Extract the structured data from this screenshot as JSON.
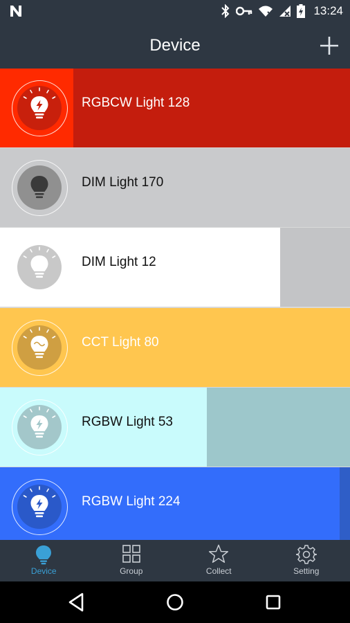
{
  "status_bar": {
    "time": "13:24"
  },
  "header": {
    "title": "Device"
  },
  "devices": [
    {
      "name": "RGBCW Light 128",
      "row_bg": "#c41d0d",
      "fill_color": "#ff2a00",
      "fill_fraction": 0.21,
      "text_color": "#ffffff",
      "circle_color": "#c8200c",
      "icon_color": "#ffffff",
      "icon": "bulb-bolt-icon"
    },
    {
      "name": "DIM Light 170",
      "row_bg": "#c9cacc",
      "fill_color": "#c9cacc",
      "fill_fraction": 0.0,
      "text_color": "#111111",
      "circle_color": "#909090",
      "icon_color": "#3a3a3a",
      "icon": "bulb-off-icon"
    },
    {
      "name": "DIM Light 12",
      "row_bg": "#c3c4c6",
      "fill_color": "#ffffff",
      "fill_fraction": 0.8,
      "text_color": "#111111",
      "circle_color": "#c8c8c8",
      "icon_color": "#ffffff",
      "icon": "bulb-on-icon"
    },
    {
      "name": "CCT Light 80",
      "row_bg": "#ffc64f",
      "fill_color": "#ffc64f",
      "fill_fraction": 1.0,
      "text_color": "#ffffff",
      "circle_color": "#cf9f42",
      "icon_color": "#ffffff",
      "icon": "bulb-wave-icon"
    },
    {
      "name": "RGBW Light 53",
      "row_bg": "#9dc7cb",
      "fill_color": "#c9fbfc",
      "fill_fraction": 0.59,
      "text_color": "#111111",
      "circle_color": "#a3c7ca",
      "icon_color": "#ffffff",
      "icon": "bulb-bolt-icon"
    },
    {
      "name": "RGBW Light 224",
      "row_bg": "#2f5ec7",
      "fill_color": "#336dfb",
      "fill_fraction": 0.97,
      "text_color": "#ffffff",
      "circle_color": "#2a59c9",
      "icon_color": "#ffffff",
      "icon": "bulb-bolt-icon"
    }
  ],
  "tabs": [
    {
      "label": "Device",
      "icon": "bulb-icon",
      "active": true
    },
    {
      "label": "Group",
      "icon": "grid-icon",
      "active": false
    },
    {
      "label": "Collect",
      "icon": "star-icon",
      "active": false
    },
    {
      "label": "Setting",
      "icon": "gear-icon",
      "active": false
    }
  ],
  "colors": {
    "bar_bg": "#2e3742",
    "accent": "#3aa0d6"
  }
}
